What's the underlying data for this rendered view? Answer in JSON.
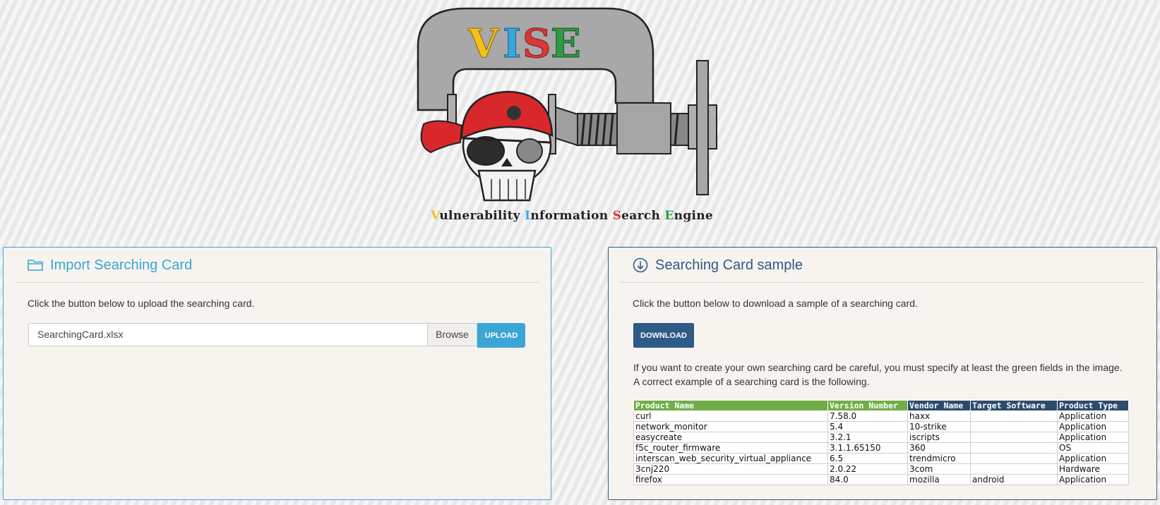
{
  "logo": {
    "title": "VISE",
    "subtitle_caps": [
      "V",
      "I",
      "S",
      "E"
    ],
    "subtitle_rest": [
      "ulnerability ",
      "nformation ",
      "earch ",
      "ngine"
    ]
  },
  "import_panel": {
    "title": "Import Searching Card",
    "intro": "Click the button below to upload the searching card.",
    "file_value": "SearchingCard.xlsx",
    "browse_label": "Browse",
    "upload_label": "UPLOAD"
  },
  "sample_panel": {
    "title": "Searching Card sample",
    "intro": "Click the button below to download a sample of a searching card.",
    "download_label": "DOWNLOAD",
    "note_line1": "If you want to create your own searching card be careful, you must specify at least the green fields in the image.",
    "note_line2": "A correct example of a searching card is the following.",
    "table": {
      "headers": [
        "Product Name",
        "Version Number",
        "Vendor Name",
        "Target Software",
        "Product Type"
      ],
      "rows": [
        [
          "curl",
          "7.58.0",
          "haxx",
          "",
          "Application"
        ],
        [
          "network_monitor",
          "5.4",
          "10-strike",
          "",
          "Application"
        ],
        [
          "easycreate",
          "3.2.1",
          "iscripts",
          "",
          "Application"
        ],
        [
          "f5c_router_firmware",
          "3.1.1.65150",
          "360",
          "",
          "OS"
        ],
        [
          "interscan_web_security_virtual_appliance",
          "6.5",
          "trendmicro",
          "",
          "Application"
        ],
        [
          "3cnj220",
          "2.0.22",
          "3com",
          "",
          "Hardware"
        ],
        [
          "firefox",
          "84.0",
          "mozilla",
          "android",
          "Application"
        ]
      ]
    }
  },
  "colors": {
    "accent_import": "#3aa6d6",
    "accent_sample": "#2d5a86",
    "header_required": "#70ad47",
    "header_optional": "#2d4b6b"
  }
}
